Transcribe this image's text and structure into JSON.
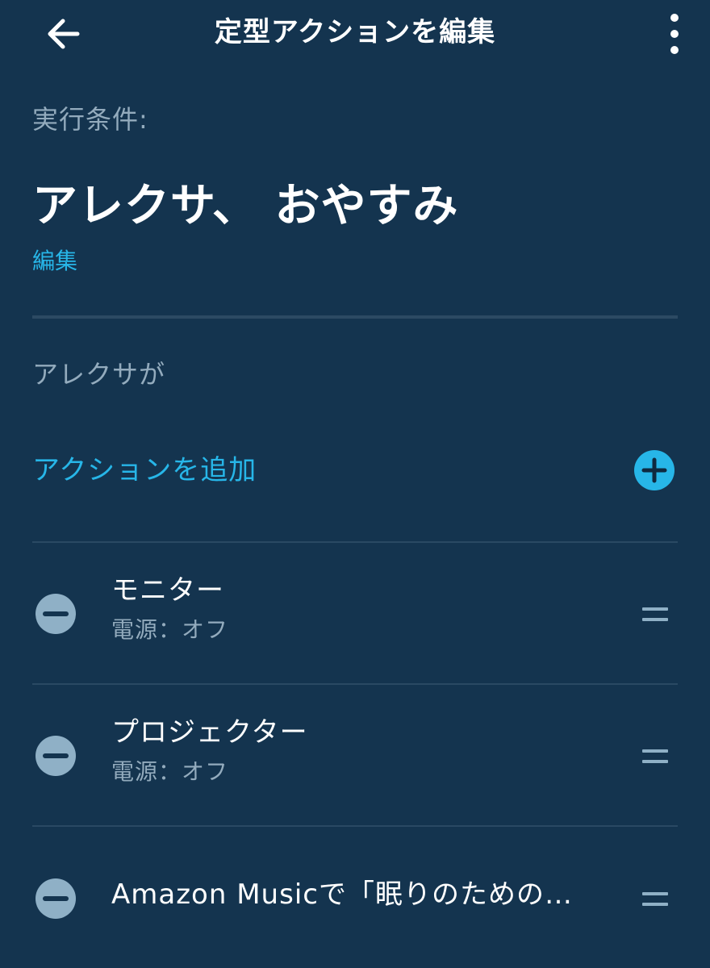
{
  "header": {
    "title": "定型アクションを編集",
    "back_icon": "arrow-left-icon",
    "more_icon": "more-vertical-icon"
  },
  "trigger": {
    "label": "実行条件:",
    "phrase": "アレクサ、 おやすみ",
    "edit_label": "編集"
  },
  "actions_section": {
    "label": "アレクサが",
    "add_label": "アクションを追加",
    "add_icon": "plus-circle-icon",
    "items": [
      {
        "title": "モニター",
        "subtitle": "電源：オフ"
      },
      {
        "title": "プロジェクター",
        "subtitle": "電源：オフ"
      },
      {
        "title": "Amazon Musicで「眠りのための…",
        "subtitle": ""
      }
    ]
  },
  "colors": {
    "background": "#14344f",
    "accent": "#27b6e8",
    "muted_text": "#93abbd",
    "icon_muted": "#8fb0c6",
    "divider": "#2a4963"
  }
}
